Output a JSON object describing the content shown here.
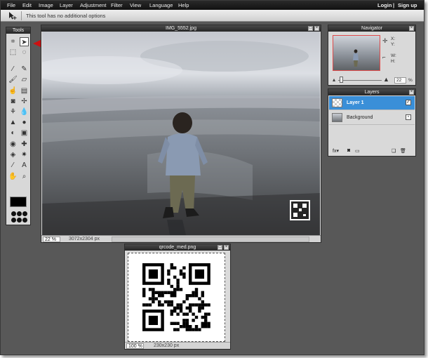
{
  "menubar": {
    "items": [
      "File",
      "Edit",
      "Image",
      "Layer",
      "Adjustment",
      "Filter",
      "View",
      "Language",
      "Help"
    ],
    "login": "Login",
    "separator": "|",
    "signup": "Sign up"
  },
  "optionsbar": {
    "tool_icon": "move-tool-icon",
    "text": "This tool has no additional options"
  },
  "tools": {
    "title": "Tools",
    "icons": [
      "crop-icon",
      "move-icon",
      "marquee-icon",
      "lasso-icon",
      "wand-icon",
      "pencil-icon",
      "brush-icon",
      "eraser-icon",
      "smudge-icon",
      "gradient-icon",
      "bucket-icon",
      "clone-icon",
      "replace-icon",
      "blur-icon",
      "sharpen-icon",
      "dodge-icon",
      "burn-icon",
      "sponge-icon",
      "redeye-icon",
      "spot-heal-icon",
      "bloat-icon",
      "pinch-icon",
      "color-picker-icon",
      "type-icon",
      "hand-icon",
      "zoom-icon"
    ],
    "selected": "move-icon",
    "foreground_color": "#000000"
  },
  "image_window": {
    "title": "IMG_5552.jpg",
    "zoom": "22",
    "zoom_unit": "%",
    "size": "3072x2304 px"
  },
  "navigator": {
    "title": "Navigator",
    "x_label": "X:",
    "y_label": "Y:",
    "w_label": "W:",
    "h_label": "H:",
    "zoom": "22",
    "zoom_unit": "%"
  },
  "layers": {
    "title": "Layers",
    "items": [
      {
        "name": "Layer 1",
        "selected": true
      },
      {
        "name": "Background",
        "selected": false
      }
    ]
  },
  "qr_window": {
    "title": "qrcode_med.png",
    "zoom": "100",
    "zoom_unit": "%",
    "size": "230x230 px"
  },
  "colors": {
    "accent": "#3a8fd8",
    "annotation_arrow": "#cc1111",
    "workspace": "#585858"
  }
}
